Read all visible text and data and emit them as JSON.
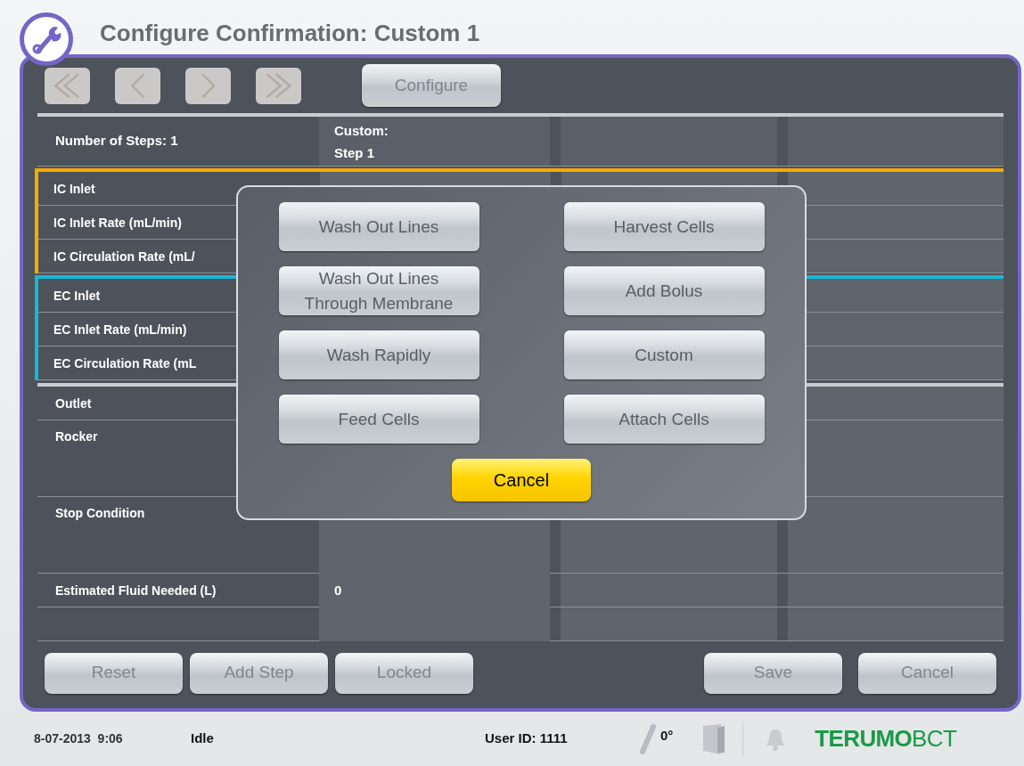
{
  "header": {
    "title": "Configure Confirmation: Custom 1"
  },
  "toolbar": {
    "nav_buttons": [
      {
        "kind": "first",
        "disabled": true
      },
      {
        "kind": "previous",
        "disabled": true
      },
      {
        "kind": "next",
        "disabled": true
      },
      {
        "kind": "last",
        "disabled": true
      }
    ],
    "configure_button": {
      "label": "Configure",
      "disabled": true
    }
  },
  "table": {
    "summary": "Number of Steps: 1",
    "step_header": "Custom:\nStep 1",
    "groups": [
      {
        "color": "#f5aa00",
        "rows": [
          {
            "label": "IC Inlet"
          },
          {
            "label": "IC Inlet Rate (mL/min)"
          },
          {
            "label": "IC Circulation Rate (mL/"
          }
        ]
      },
      {
        "color": "#16b8d8",
        "rows": [
          {
            "label": "EC Inlet"
          },
          {
            "label": "EC Inlet Rate (mL/min)"
          },
          {
            "label": "EC Circulation Rate (mL"
          }
        ]
      },
      {
        "rows": [
          {
            "label": "Outlet"
          },
          {
            "label": "Rocker"
          },
          {
            "label": "Stop Condition"
          },
          {
            "label": "Estimated Fluid Needed (L)",
            "value": "0"
          },
          {}
        ]
      }
    ]
  },
  "bottom_bar": {
    "left_buttons": [
      {
        "label": "Reset",
        "disabled": true
      },
      {
        "label": "Add Step",
        "disabled": true
      },
      {
        "label": "Locked",
        "disabled": true
      }
    ],
    "right_buttons": [
      {
        "label": "Save",
        "disabled": true
      },
      {
        "label": "Cancel",
        "disabled": true
      }
    ]
  },
  "dialog": {
    "options": [
      {
        "label": "Wash Out Lines"
      },
      {
        "label": "Harvest Cells"
      },
      {
        "label": "Wash Out Lines\nThrough Membrane"
      },
      {
        "label": "Add Bolus"
      },
      {
        "label": "Wash Rapidly"
      },
      {
        "label": "Custom"
      },
      {
        "label": "Feed Cells"
      },
      {
        "label": "Attach Cells"
      }
    ],
    "cancel_button": "Cancel"
  },
  "status_bar": {
    "datetime": "8-07-2013  9:06",
    "state": "Idle",
    "user": "User ID: 1111",
    "rotation": "0°",
    "logo": "**TERUMO**BCT"
  }
}
